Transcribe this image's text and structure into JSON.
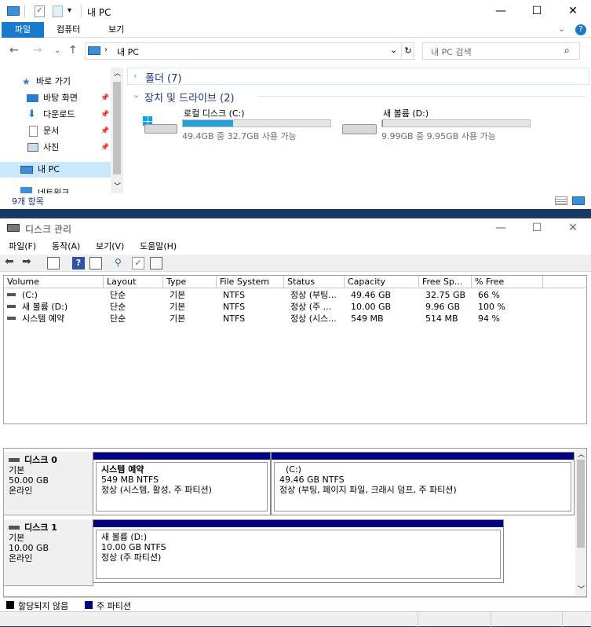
{
  "explorer": {
    "title": "내 PC",
    "ribbon_tabs": [
      "파일",
      "컴퓨터",
      "보기"
    ],
    "address": "내 PC",
    "search_placeholder": "내 PC 검색",
    "sidebar": [
      {
        "label": "바로 가기",
        "icon": "star-icon"
      },
      {
        "label": "바탕 화면",
        "icon": "desktop-icon"
      },
      {
        "label": "다운로드",
        "icon": "download-icon"
      },
      {
        "label": "문서",
        "icon": "document-icon"
      },
      {
        "label": "사진",
        "icon": "picture-icon"
      },
      {
        "label": "내 PC",
        "icon": "computer-icon"
      },
      {
        "label": "네트워크",
        "icon": "network-icon"
      }
    ],
    "groups": {
      "folders": "폴더 (7)",
      "devices": "장치 및 드라이브 (2)"
    },
    "drives": [
      {
        "name": "로컬 디스크 (C:)",
        "detail": "49.4GB 중 32.7GB 사용 가능",
        "used_fraction": 0.338,
        "accent": "#26a0da"
      },
      {
        "name": "새 볼륨 (D:)",
        "detail": "9.99GB 중 9.95GB 사용 가능",
        "used_fraction": 0.004,
        "accent": "#26a0da"
      }
    ],
    "status": "9개 항목"
  },
  "disk_mgmt": {
    "title": "디스크 관리",
    "menu": [
      "파일(F)",
      "동작(A)",
      "보기(V)",
      "도움말(H)"
    ],
    "columns": [
      "Volume",
      "Layout",
      "Type",
      "File System",
      "Status",
      "Capacity",
      "Free Sp...",
      "% Free"
    ],
    "rows": [
      [
        "(C:)",
        "단순",
        "기본",
        "NTFS",
        "정상 (부팅...",
        "49.46 GB",
        "32.75 GB",
        "66 %"
      ],
      [
        "새 볼륨 (D:)",
        "단순",
        "기본",
        "NTFS",
        "정상 (주 ...",
        "10.00 GB",
        "9.96 GB",
        "100 %"
      ],
      [
        "시스템 예약",
        "단순",
        "기본",
        "NTFS",
        "정상 (시스...",
        "549 MB",
        "514 MB",
        "94 %"
      ]
    ],
    "disks": [
      {
        "name": "디스크 0",
        "kind": "기본",
        "size": "50.00 GB",
        "state": "온라인",
        "partitions": [
          {
            "name": "시스템 예약",
            "size": "549 MB NTFS",
            "status": "정상 (시스템, 활성, 주 파티션)"
          },
          {
            "name": "(C:)",
            "size": "49.46 GB NTFS",
            "status": "정상 (부팅, 페이지 파일, 크래시 덤프, 주 파티션)"
          }
        ]
      },
      {
        "name": "디스크 1",
        "kind": "기본",
        "size": "10.00 GB",
        "state": "온라인",
        "partitions": [
          {
            "name": "새 볼륨  (D:)",
            "size": "10.00 GB NTFS",
            "status": "정상 (주 파티션)"
          }
        ]
      }
    ],
    "legend": [
      {
        "label": "할당되지 않음",
        "color": "#000000"
      },
      {
        "label": "주 파티션",
        "color": "#000080"
      }
    ]
  }
}
